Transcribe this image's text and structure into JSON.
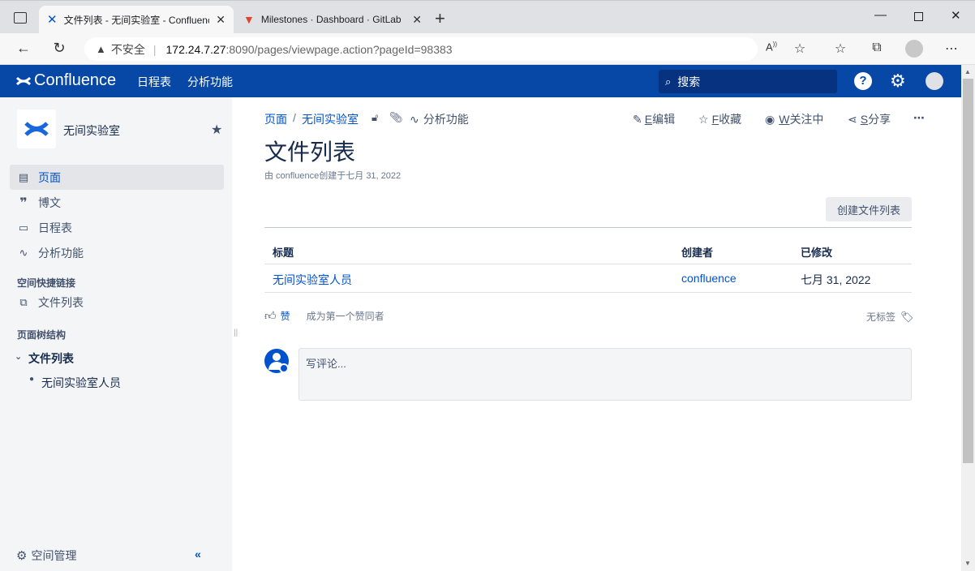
{
  "browser": {
    "tabs": [
      {
        "title": "文件列表 - 无间实验室 - Confluence",
        "active": true
      },
      {
        "title": "Milestones · Dashboard · GitLab",
        "active": false
      }
    ],
    "new_tab": "+",
    "address": {
      "insecure_label": "不安全",
      "url_host": "172.24.7.27",
      "url_rest": ":8090/pages/viewpage.action?pageId=98383"
    }
  },
  "header": {
    "brand": "Confluence",
    "nav": [
      "日程表",
      "分析功能"
    ],
    "search_placeholder": "搜索"
  },
  "sidebar": {
    "space_name": "无间实验室",
    "items": [
      {
        "label": "页面",
        "icon": "page-icon",
        "selected": true
      },
      {
        "label": "博文",
        "icon": "quote-icon",
        "selected": false
      },
      {
        "label": "日程表",
        "icon": "calendar-icon",
        "selected": false
      },
      {
        "label": "分析功能",
        "icon": "analytics-icon",
        "selected": false
      }
    ],
    "shortcuts_heading": "空间快捷链接",
    "shortcut": "文件列表",
    "tree_heading": "页面树结构",
    "tree_root": "文件列表",
    "tree_child": "无间实验室人员",
    "space_admin": "空间管理"
  },
  "page": {
    "breadcrumb": [
      "页面",
      "无间实验室"
    ],
    "analytics": "分析功能",
    "actions": {
      "edit_key": "E",
      "edit": "编辑",
      "save_key": "F",
      "save": "收藏",
      "watch_key": "W",
      "watch": "关注中",
      "share_key": "S",
      "share": "分享"
    },
    "title": "文件列表",
    "byline": "由 confluence创建于七月 31, 2022",
    "create_button": "创建文件列表",
    "table": {
      "headers": [
        "标题",
        "创建者",
        "已修改"
      ],
      "rows": [
        {
          "title": "无间实验室人员",
          "creator": "confluence",
          "modified": "七月 31, 2022"
        }
      ]
    },
    "like": "赞",
    "like_hint": "成为第一个赞同者",
    "no_labels": "无标签",
    "comment_placeholder": "写评论..."
  },
  "colors": {
    "header_bg": "#0747a6",
    "link": "#0052cc",
    "sidebar_bg": "#f4f5f7"
  }
}
